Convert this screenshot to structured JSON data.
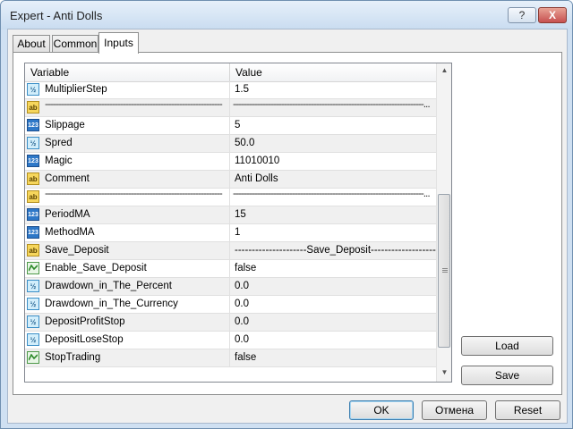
{
  "window": {
    "title": "Expert - Anti Dolls",
    "help_label": "?",
    "close_label": "X"
  },
  "tabs": [
    {
      "label": "About"
    },
    {
      "label": "Common"
    },
    {
      "label": "Inputs"
    }
  ],
  "grid": {
    "col_variable": "Variable",
    "col_value": "Value"
  },
  "rows": [
    {
      "type": "dbl",
      "name": "MultiplierStep",
      "value": "1.5"
    },
    {
      "type": "str",
      "name": "------------------------------------------------------------------",
      "value": "-----------------------------------------------------------------------..."
    },
    {
      "type": "int",
      "name": "Slippage",
      "value": "5"
    },
    {
      "type": "dbl",
      "name": "Spred",
      "value": "50.0"
    },
    {
      "type": "int",
      "name": "Magic",
      "value": "11010010"
    },
    {
      "type": "str",
      "name": "Comment",
      "value": "Anti Dolls"
    },
    {
      "type": "str",
      "name": "------------------------------------------------------------------",
      "value": "-----------------------------------------------------------------------..."
    },
    {
      "type": "int",
      "name": "PeriodMA",
      "value": "15"
    },
    {
      "type": "int",
      "name": "MethodMA",
      "value": "1"
    },
    {
      "type": "str",
      "name": "Save_Deposit",
      "value": "---------------------Save_Deposit---------------------"
    },
    {
      "type": "bool",
      "name": "Enable_Save_Deposit",
      "value": "false"
    },
    {
      "type": "dbl",
      "name": "Drawdown_in_The_Percent",
      "value": "0.0"
    },
    {
      "type": "dbl",
      "name": "Drawdown_in_The_Currency",
      "value": "0.0"
    },
    {
      "type": "dbl",
      "name": "DepositProfitStop",
      "value": "0.0"
    },
    {
      "type": "dbl",
      "name": "DepositLoseStop",
      "value": "0.0"
    },
    {
      "type": "bool",
      "name": "StopTrading",
      "value": "false"
    }
  ],
  "icons": {
    "dbl": "double-type-icon",
    "int": "integer-type-icon",
    "str": "string-type-icon",
    "bool": "boolean-type-icon"
  },
  "icon_text": {
    "dbl": "½",
    "int": "123",
    "str": "ab"
  },
  "side_buttons": {
    "load": "Load",
    "save": "Save"
  },
  "footer": {
    "ok": "OK",
    "cancel": "Отмена",
    "reset": "Reset"
  }
}
